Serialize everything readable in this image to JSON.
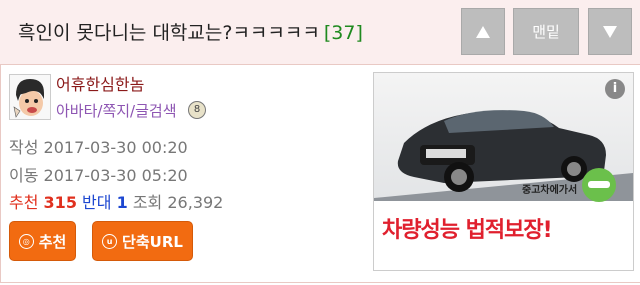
{
  "header": {
    "title": "흑인이 못다니는 대학교는?ㅋㅋㅋㅋㅋ",
    "comment_count": "[37]",
    "bottom_label": "맨밑"
  },
  "author": {
    "nickname": "어휴한심한놈",
    "links": "아바타/쪽지/글검색",
    "badge": "8"
  },
  "meta": {
    "written_label": "작성",
    "written_date": "2017-03-30 00:20",
    "moved_label": "이동",
    "moved_date": "2017-03-30 05:20",
    "recommend_label": "추천",
    "recommend_count": "315",
    "oppose_label": "반대",
    "oppose_count": "1",
    "views_label": "조회",
    "views_count": "26,392"
  },
  "buttons": {
    "recommend_label": "추천",
    "shorturl_label": "단축URL"
  },
  "ad": {
    "info_label": "i",
    "brand": "중고차에가서",
    "headline": "차량성능 법적보장!"
  },
  "colors": {
    "header_bg": "#fbeeee",
    "accent_orange": "#f26b11",
    "recommend_red": "#e0301e",
    "oppose_blue": "#1d47d1",
    "count_green": "#1f8a1f",
    "nickname": "#8b1a1a",
    "links_purple": "#8e56b3"
  }
}
